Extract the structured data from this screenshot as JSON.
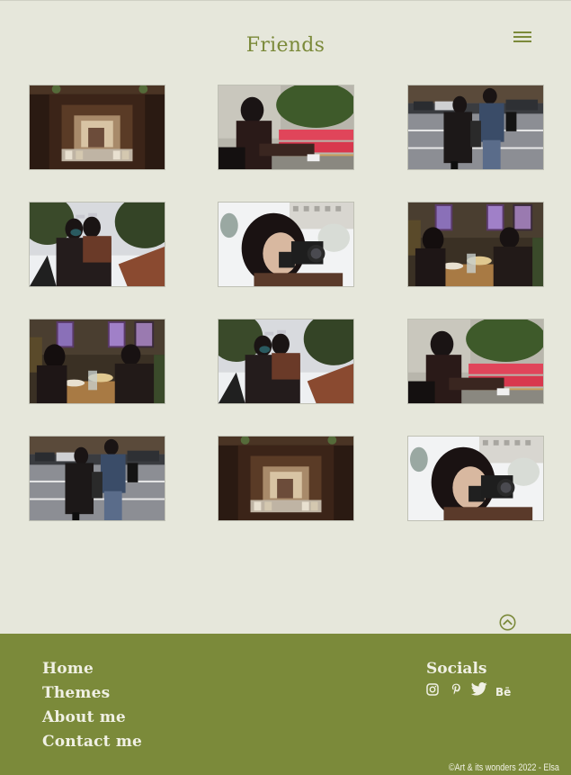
{
  "page": {
    "title": "Friends",
    "menu_icon": "hamburger-menu-icon",
    "scroll_top_icon": "chevron-up-circle-icon"
  },
  "colors": {
    "background": "#e6e7db",
    "accent": "#7b8a3a",
    "footer_text": "#f0f0e4"
  },
  "gallery": {
    "photos": [
      {
        "subject": "restaurant-mirror"
      },
      {
        "subject": "friend-on-red-bench"
      },
      {
        "subject": "friends-on-street"
      },
      {
        "subject": "friends-hugging-in-snow"
      },
      {
        "subject": "girl-with-camera"
      },
      {
        "subject": "friends-at-dinner-table"
      },
      {
        "subject": "friends-at-dinner-table"
      },
      {
        "subject": "friends-hugging-in-snow"
      },
      {
        "subject": "friend-on-red-bench"
      },
      {
        "subject": "friends-on-street"
      },
      {
        "subject": "restaurant-mirror"
      },
      {
        "subject": "girl-with-camera"
      }
    ]
  },
  "footer": {
    "nav": [
      {
        "label": "Home"
      },
      {
        "label": "Themes"
      },
      {
        "label": "About me"
      },
      {
        "label": "Contact me"
      }
    ],
    "socials_heading": "Socials",
    "social_icons": [
      "instagram-icon",
      "pinterest-icon",
      "twitter-icon",
      "behance-icon"
    ],
    "behance_label": "Bē",
    "copyright": "©Art & its wonders 2022 - Elsa"
  }
}
